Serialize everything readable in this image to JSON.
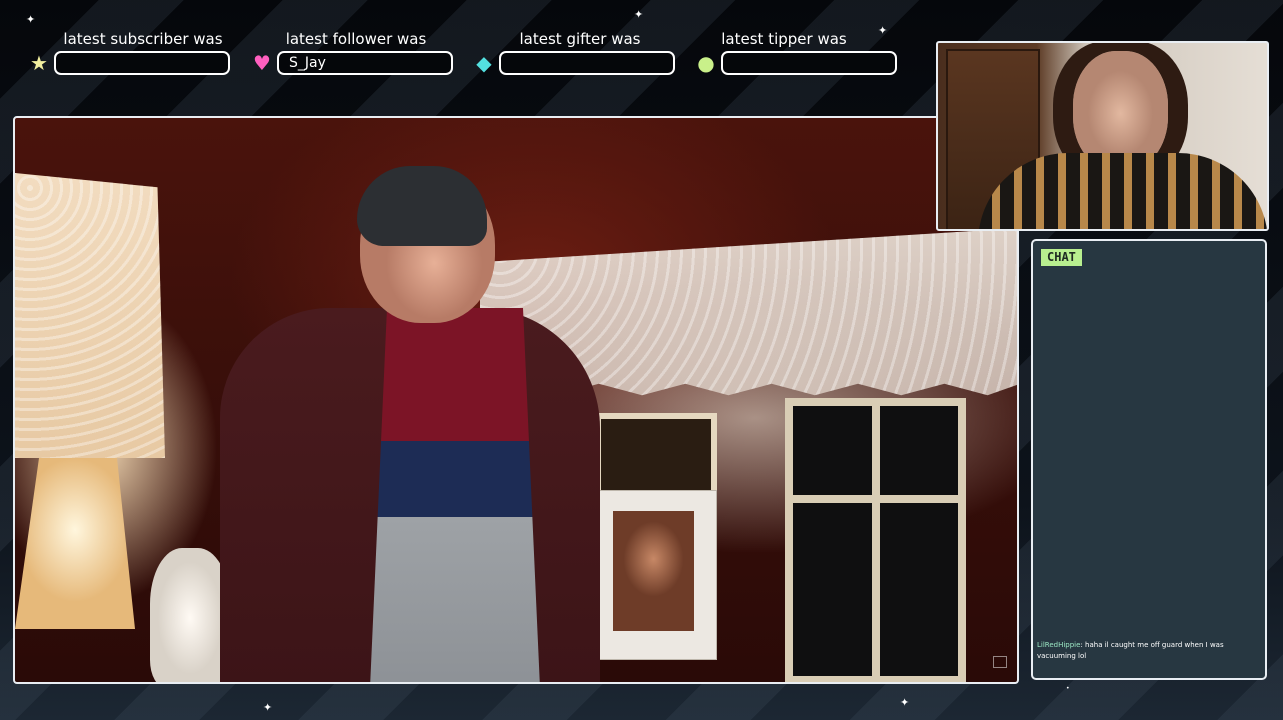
{
  "alerts": [
    {
      "label": "latest subscriber was",
      "value": "",
      "icon": "star-icon",
      "color": "#f2f0a0",
      "glyph": "★"
    },
    {
      "label": "latest follower was",
      "value": "S_Jay",
      "icon": "heart-icon",
      "color": "#ff5fbf",
      "glyph": "♥"
    },
    {
      "label": "latest gifter was",
      "value": "",
      "icon": "gem-icon",
      "color": "#53e0e0",
      "glyph": "◆"
    },
    {
      "label": "latest tipper was",
      "value": "",
      "icon": "coin-icon",
      "color": "#c9f08a",
      "glyph": "●"
    }
  ],
  "chat": {
    "badge": "CHAT",
    "message": {
      "user": "LilRedHippie",
      "separator": ": ",
      "text": "haha il caught me off guard when I was vacuuming lol"
    }
  }
}
